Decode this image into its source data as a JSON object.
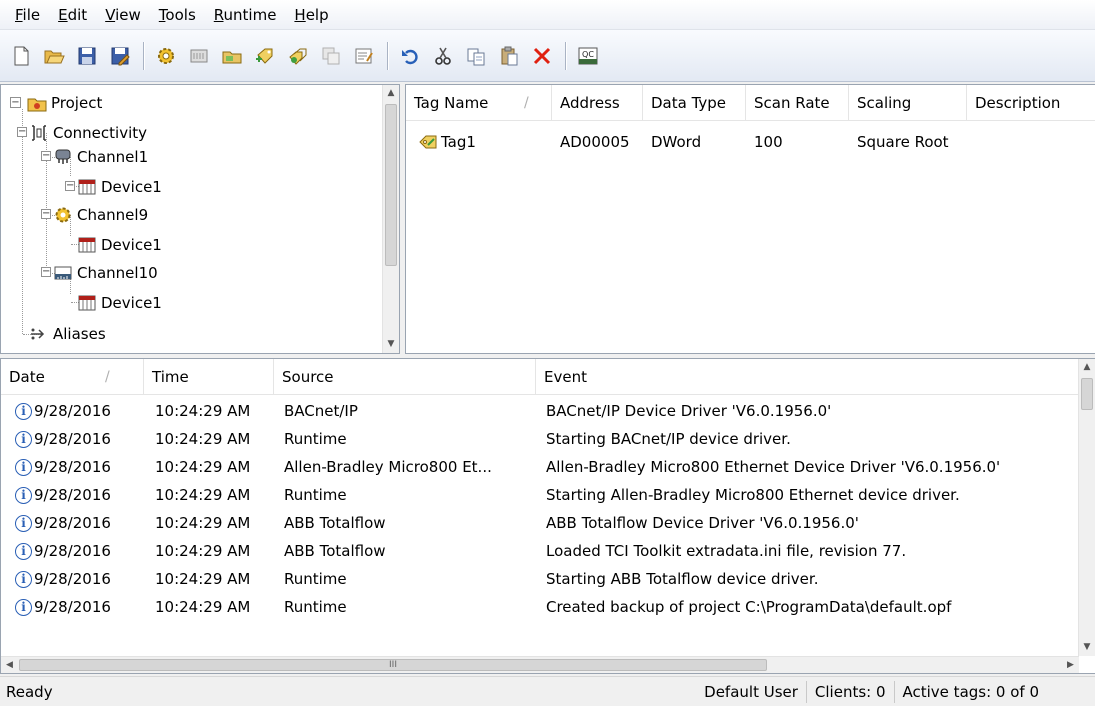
{
  "menu": [
    {
      "m": "F",
      "r": "ile"
    },
    {
      "m": "E",
      "r": "dit"
    },
    {
      "m": "V",
      "r": "iew"
    },
    {
      "m": "T",
      "r": "ools"
    },
    {
      "m": "R",
      "r": "untime"
    },
    {
      "m": "H",
      "r": "elp"
    }
  ],
  "toolbar": {
    "icons": [
      "new-icon",
      "open-icon",
      "save-icon",
      "save-as-icon",
      "new-channel-icon",
      "new-device-icon",
      "new-tag-group-icon",
      "new-tag-icon",
      "bulk-tag-icon",
      "duplicate-icon",
      "properties-icon",
      "undo-icon",
      "cut-icon",
      "copy-icon",
      "paste-icon",
      "delete-icon",
      "quick-client-icon"
    ],
    "qc_label": "QC"
  },
  "tree": {
    "project": "Project",
    "connectivity": "Connectivity",
    "channel1": "Channel1",
    "channel1_device": "Device1",
    "channel9": "Channel9",
    "channel9_device": "Device1",
    "channel10": "Channel10",
    "channel10_device": "Device1",
    "aliases": "Aliases"
  },
  "tags": {
    "headers": {
      "name": "Tag Name",
      "address": "Address",
      "type": "Data Type",
      "rate": "Scan Rate",
      "scaling": "Scaling",
      "desc": "Description"
    },
    "rows": [
      {
        "name": "Tag1",
        "address": "AD00005",
        "type": "DWord",
        "rate": "100",
        "scaling": "Square Root",
        "desc": ""
      }
    ]
  },
  "events": {
    "headers": {
      "date": "Date",
      "time": "Time",
      "source": "Source",
      "event": "Event"
    },
    "rows": [
      {
        "date": "9/28/2016",
        "time": "10:24:29 AM",
        "source": "BACnet/IP",
        "event": "BACnet/IP Device Driver 'V6.0.1956.0'"
      },
      {
        "date": "9/28/2016",
        "time": "10:24:29 AM",
        "source": "Runtime",
        "event": "Starting BACnet/IP device driver."
      },
      {
        "date": "9/28/2016",
        "time": "10:24:29 AM",
        "source": "Allen-Bradley Micro800 Et...",
        "event": "Allen-Bradley Micro800 Ethernet Device Driver 'V6.0.1956.0'"
      },
      {
        "date": "9/28/2016",
        "time": "10:24:29 AM",
        "source": "Runtime",
        "event": "Starting Allen-Bradley Micro800 Ethernet device driver."
      },
      {
        "date": "9/28/2016",
        "time": "10:24:29 AM",
        "source": "ABB Totalflow",
        "event": "ABB Totalflow Device Driver 'V6.0.1956.0'"
      },
      {
        "date": "9/28/2016",
        "time": "10:24:29 AM",
        "source": "ABB Totalflow",
        "event": "Loaded TCI Toolkit extradata.ini file, revision 77."
      },
      {
        "date": "9/28/2016",
        "time": "10:24:29 AM",
        "source": "Runtime",
        "event": "Starting ABB Totalflow device driver."
      },
      {
        "date": "9/28/2016",
        "time": "10:24:29 AM",
        "source": "Runtime",
        "event": "Created backup of project  C:\\ProgramData\\default.opf"
      }
    ],
    "hscroll_glyph": "III"
  },
  "status": {
    "state": "Ready",
    "user": "Default User",
    "clients": "Clients: 0",
    "active_tags": "Active tags: 0 of 0"
  }
}
